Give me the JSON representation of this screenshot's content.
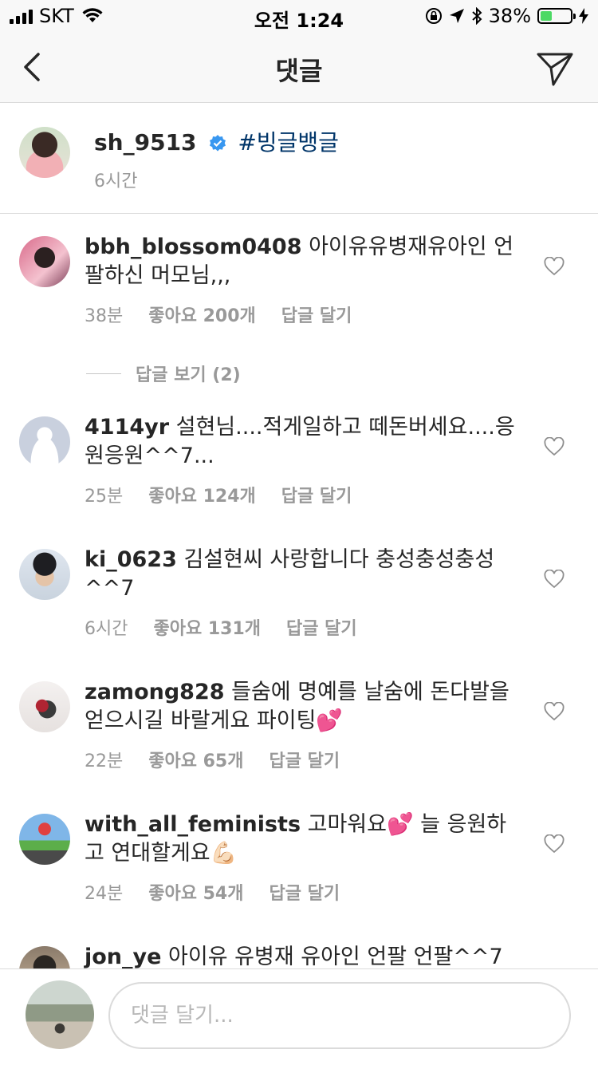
{
  "status_bar": {
    "carrier": "SKT",
    "time": "오전 1:24",
    "battery": "38%",
    "battery_level": 0.38,
    "icons": [
      "signal-icon",
      "wifi-icon",
      "orientation-lock-icon",
      "location-icon",
      "bluetooth-icon",
      "battery-icon",
      "charging-icon"
    ]
  },
  "header": {
    "title": "댓글",
    "back_icon": "chevron-left-icon",
    "send_icon": "paper-plane-icon"
  },
  "caption": {
    "username": "sh_9513",
    "verified": true,
    "text": "#빙글뱅글",
    "time": "6시간"
  },
  "comments": [
    {
      "username": "bbh_blossom0408",
      "text": "아이유유병재유아인 언팔하신 머모님,,,",
      "time": "38분",
      "likes": "좋아요 200개",
      "reply": "답글 달기"
    },
    {
      "username": "4114yr",
      "text": "설현님....적게일하고 떼돈버세요....응원응원^^7...",
      "time": "25분",
      "likes": "좋아요 124개",
      "reply": "답글 달기"
    },
    {
      "username": "ki_0623",
      "text": "김설현씨 사랑합니다 충성충성충성^^7",
      "time": "6시간",
      "likes": "좋아요 131개",
      "reply": "답글 달기"
    },
    {
      "username": "zamong828",
      "text": "들숨에 명예를 날숨에 돈다발을 얻으시길 바랄게요 파이팅💕",
      "time": "22분",
      "likes": "좋아요 65개",
      "reply": "답글 달기"
    },
    {
      "username": "with_all_feminists",
      "text": "고마워요💕 늘 응원하고 연대할게요💪🏻",
      "time": "24분",
      "likes": "좋아요 54개",
      "reply": "답글 달기"
    },
    {
      "username": "jon_ye",
      "text": "아이유 유병재 유아인 언팔 언팔^^7"
    }
  ],
  "view_replies": "답글 보기 (2)",
  "input": {
    "placeholder": "댓글 달기..."
  },
  "colors": {
    "link": "#003569",
    "verified": "#3897f0",
    "meta": "#999999",
    "battery": "#4cd964"
  }
}
